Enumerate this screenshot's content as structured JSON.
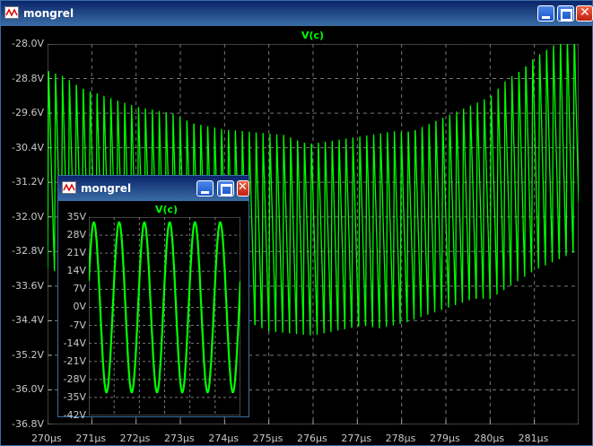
{
  "main_window": {
    "title": "mongrel",
    "trace_label": "V(c)",
    "y_ticks": [
      "-28.0V",
      "-28.8V",
      "-29.6V",
      "-30.4V",
      "-31.2V",
      "-32.0V",
      "-32.8V",
      "-33.6V",
      "-34.4V",
      "-35.2V",
      "-36.0V",
      "-36.8V"
    ],
    "x_ticks": [
      "270µs",
      "271µs",
      "272µs",
      "273µs",
      "274µs",
      "275µs",
      "276µs",
      "277µs",
      "278µs",
      "279µs",
      "280µs",
      "281µs"
    ],
    "colors": {
      "trace": "#00ff00",
      "grid": "#777777",
      "background": "#000000",
      "title_bar": "#0a246a"
    }
  },
  "inset_window": {
    "title": "mongrel",
    "trace_label": "V(c)",
    "y_ticks": [
      "35V",
      "28V",
      "21V",
      "14V",
      "7V",
      "0V",
      "-7V",
      "-14V",
      "-21V",
      "-28V",
      "-35V",
      "-42V"
    ]
  },
  "chart_data": [
    {
      "type": "line",
      "title": "V(c)",
      "xlabel": "",
      "ylabel": "",
      "xlim": [
        270,
        282
      ],
      "ylim": [
        -36.8,
        -28.0
      ],
      "x_unit": "µs",
      "y_unit": "V",
      "grid": true,
      "series": [
        {
          "name": "V(c)",
          "cycles_per_us": 6.4,
          "upper_envelope": {
            "x": [
              270,
              272,
              274,
              276,
              278,
              280,
              281,
              282
            ],
            "y": [
              -28.6,
              -29.4,
              -29.9,
              -30.2,
              -30.0,
              -29.2,
              -28.2,
              -27.6
            ]
          },
          "lower_envelope": {
            "x": [
              270,
              272,
              274,
              276,
              278,
              280,
              281,
              282
            ],
            "y": [
              -33.2,
              -34.0,
              -34.5,
              -34.8,
              -34.5,
              -33.9,
              -33.3,
              -32.9
            ]
          }
        }
      ]
    },
    {
      "type": "line",
      "title": "V(c)",
      "xlabel": "",
      "ylabel": "",
      "ylim": [
        -42,
        35
      ],
      "y_unit": "V",
      "grid": true,
      "series": [
        {
          "name": "V(c)",
          "cycles": 6,
          "amplitude": 33
        }
      ]
    }
  ]
}
